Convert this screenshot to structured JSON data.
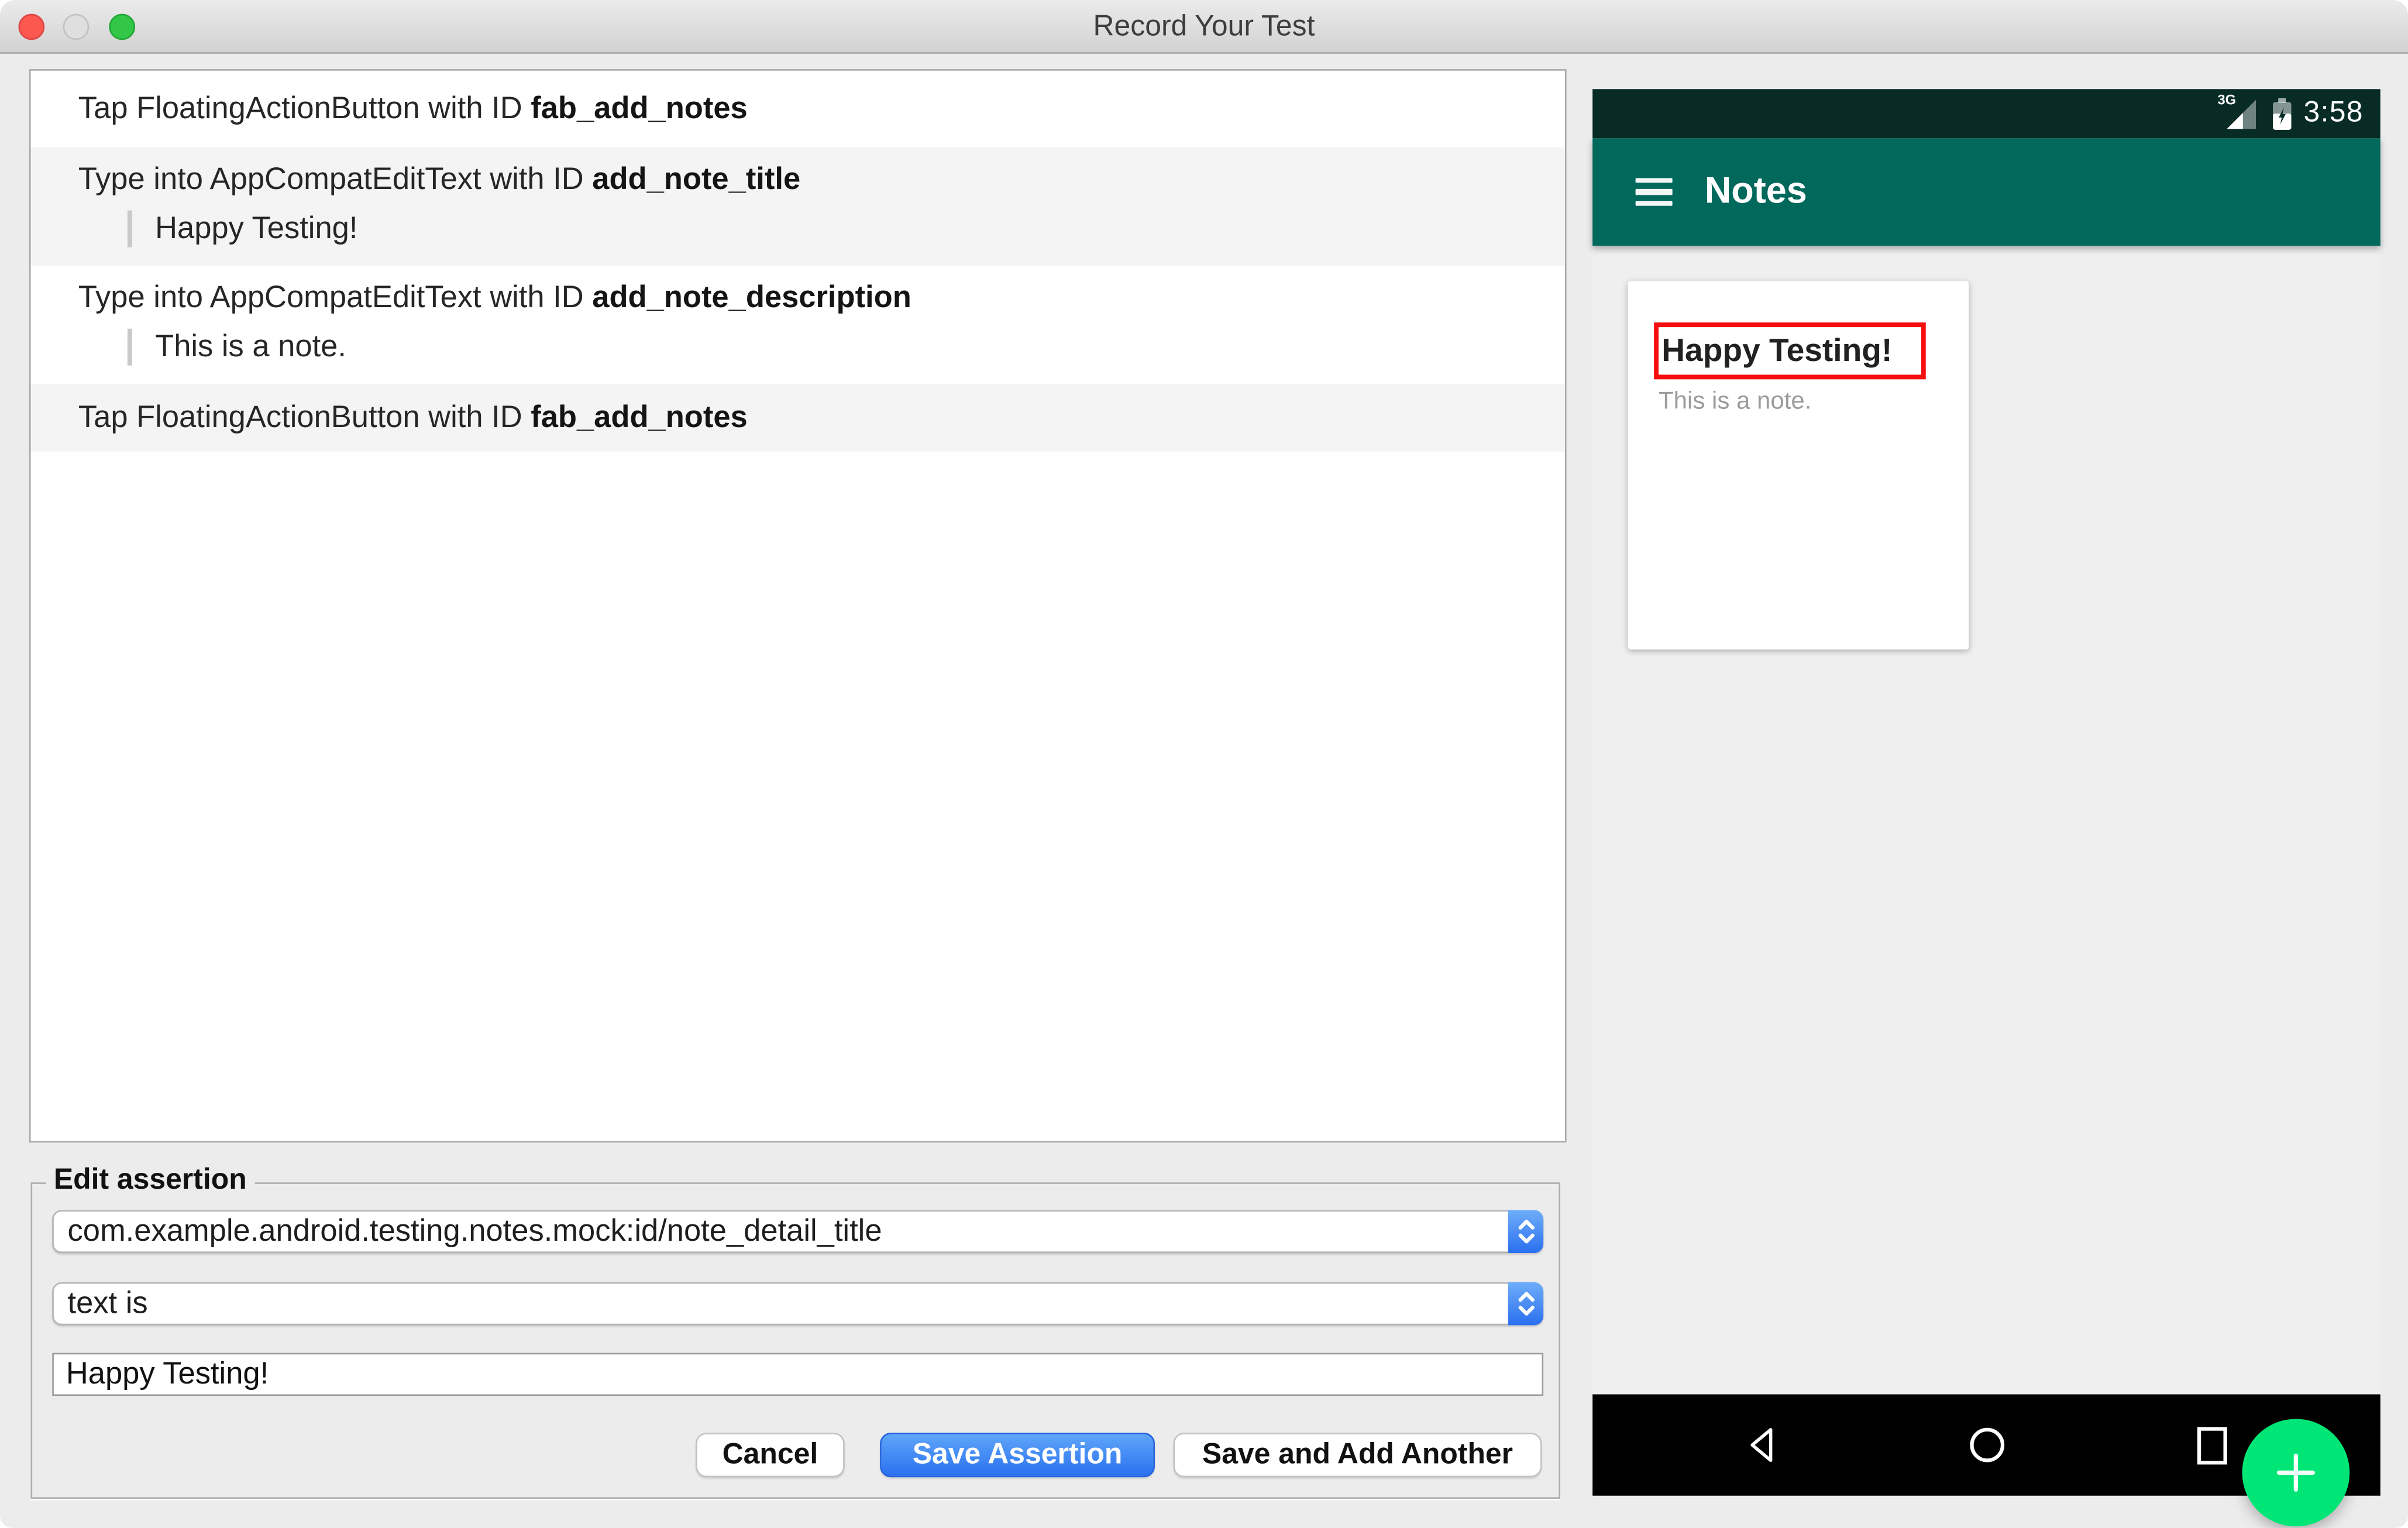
{
  "window": {
    "title": "Record Your Test"
  },
  "recorded_actions": [
    {
      "action": "Tap FloatingActionButton with ID",
      "target_id": "fab_add_notes"
    },
    {
      "action": "Type into AppCompatEditText with ID",
      "target_id": "add_note_title",
      "typed_text": "Happy Testing!"
    },
    {
      "action": "Type into AppCompatEditText with ID",
      "target_id": "add_note_description",
      "typed_text": "This is a note."
    },
    {
      "action": "Tap FloatingActionButton with ID",
      "target_id": "fab_add_notes"
    }
  ],
  "edit_assertion": {
    "legend": "Edit assertion",
    "element_id_value": "com.example.android.testing.notes.mock:id/note_detail_title",
    "condition_value": "text is",
    "text_value": "Happy Testing!",
    "cancel_label": "Cancel",
    "save_label": "Save Assertion",
    "save_add_label": "Save and Add Another"
  },
  "device_screen": {
    "status_bar": {
      "network": "3G",
      "time": "3:58"
    },
    "toolbar": {
      "title": "Notes"
    },
    "note_card": {
      "title": "Happy Testing!",
      "description": "This is a note."
    }
  },
  "colors": {
    "window_bg": "#ECECEC",
    "toolbar_teal": "#00695C",
    "status_bar_teal": "#082B26",
    "fab_green": "#00E676",
    "assertion_highlight_red": "#F50F0F",
    "primary_button_blue": "#2A71F0",
    "combo_stepper_blue": "#3A82F4",
    "list_alt_row": "#F4F4F4"
  },
  "icons": {
    "traffic_lights": [
      "close-icon",
      "minimize-icon",
      "zoom-icon"
    ],
    "combo": "up-down-stepper-icon",
    "toolbar": "hamburger-menu-icon",
    "status": [
      "cellular-signal-icon",
      "battery-charging-icon"
    ],
    "fab": "plus-icon",
    "navigation": [
      "back-icon",
      "home-icon",
      "recents-icon"
    ]
  }
}
